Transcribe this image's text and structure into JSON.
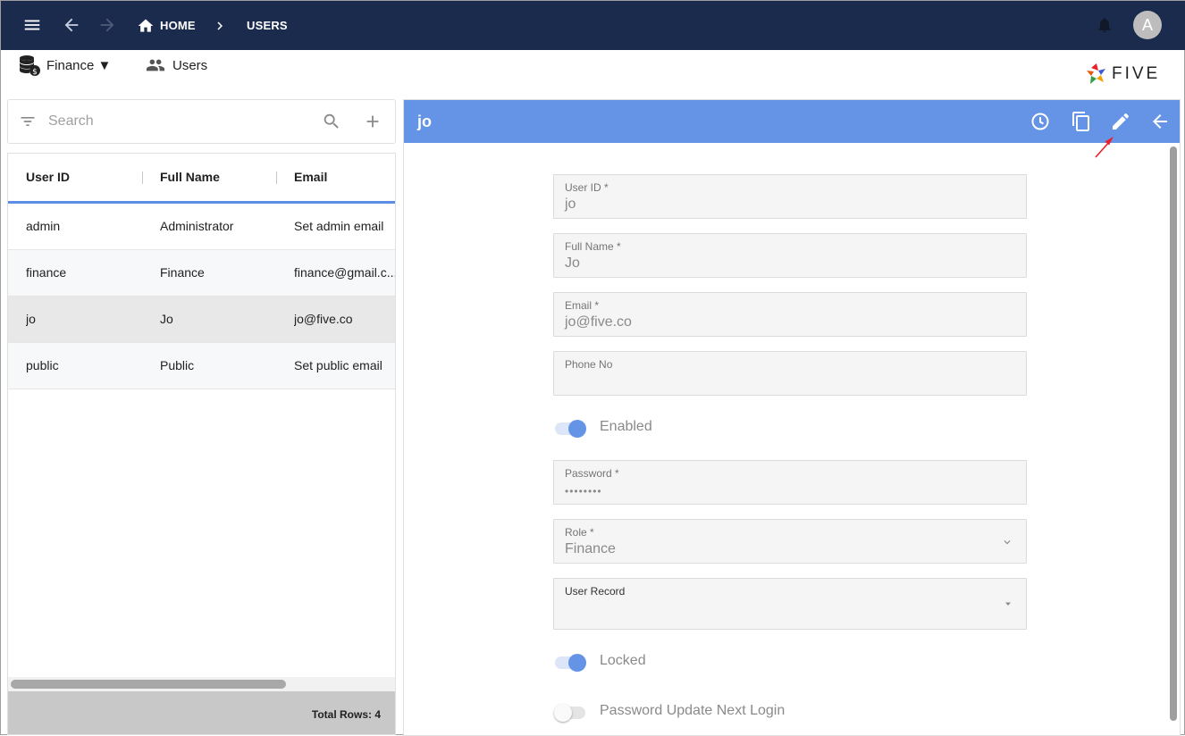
{
  "breadcrumb": {
    "home": "HOME",
    "users": "USERS"
  },
  "user_avatar": "A",
  "subnav": {
    "app": "Finance ▼",
    "users": "Users"
  },
  "logo_text": "FIVE",
  "search": {
    "placeholder": "Search"
  },
  "grid": {
    "columns": [
      "User ID",
      "Full Name",
      "Email"
    ],
    "rows": [
      [
        "admin",
        "Administrator",
        "Set admin email"
      ],
      [
        "finance",
        "Finance",
        "finance@gmail.c..."
      ],
      [
        "jo",
        "Jo",
        "jo@five.co"
      ],
      [
        "public",
        "Public",
        "Set public email"
      ]
    ],
    "selected_row": 2,
    "total": "Total Rows: 4"
  },
  "form": {
    "title": "jo",
    "fields": [
      {
        "label": "User ID *",
        "value": "jo"
      },
      {
        "label": "Full Name *",
        "value": "Jo"
      },
      {
        "label": "Email *",
        "value": "jo@five.co"
      },
      {
        "label": "Phone No",
        "value": ""
      },
      {
        "label": "Password *",
        "value": "••••••••"
      },
      {
        "label": "Role *",
        "value": "Finance"
      },
      {
        "label": "User Record",
        "value": ""
      }
    ],
    "toggles": [
      {
        "label": "Enabled",
        "on": true
      },
      {
        "label": "Locked",
        "on": true
      },
      {
        "label": "Password Update Next Login",
        "on": false
      }
    ]
  },
  "colors": {
    "topbar": "#1b2b4e",
    "form_header": "#6594e6",
    "accent": "#5c8ee6",
    "annotation_arrow": "#e8212a"
  },
  "icons": [
    "menu-icon",
    "back-icon",
    "forward-icon",
    "home-icon",
    "chevron-right-icon",
    "bell-icon",
    "database-icon",
    "users-icon",
    "filter-icon",
    "search-icon",
    "add-icon",
    "history-icon",
    "copy-icon",
    "edit-icon",
    "arrow-back-icon",
    "chevron-down-icon",
    "dropdown-icon"
  ]
}
